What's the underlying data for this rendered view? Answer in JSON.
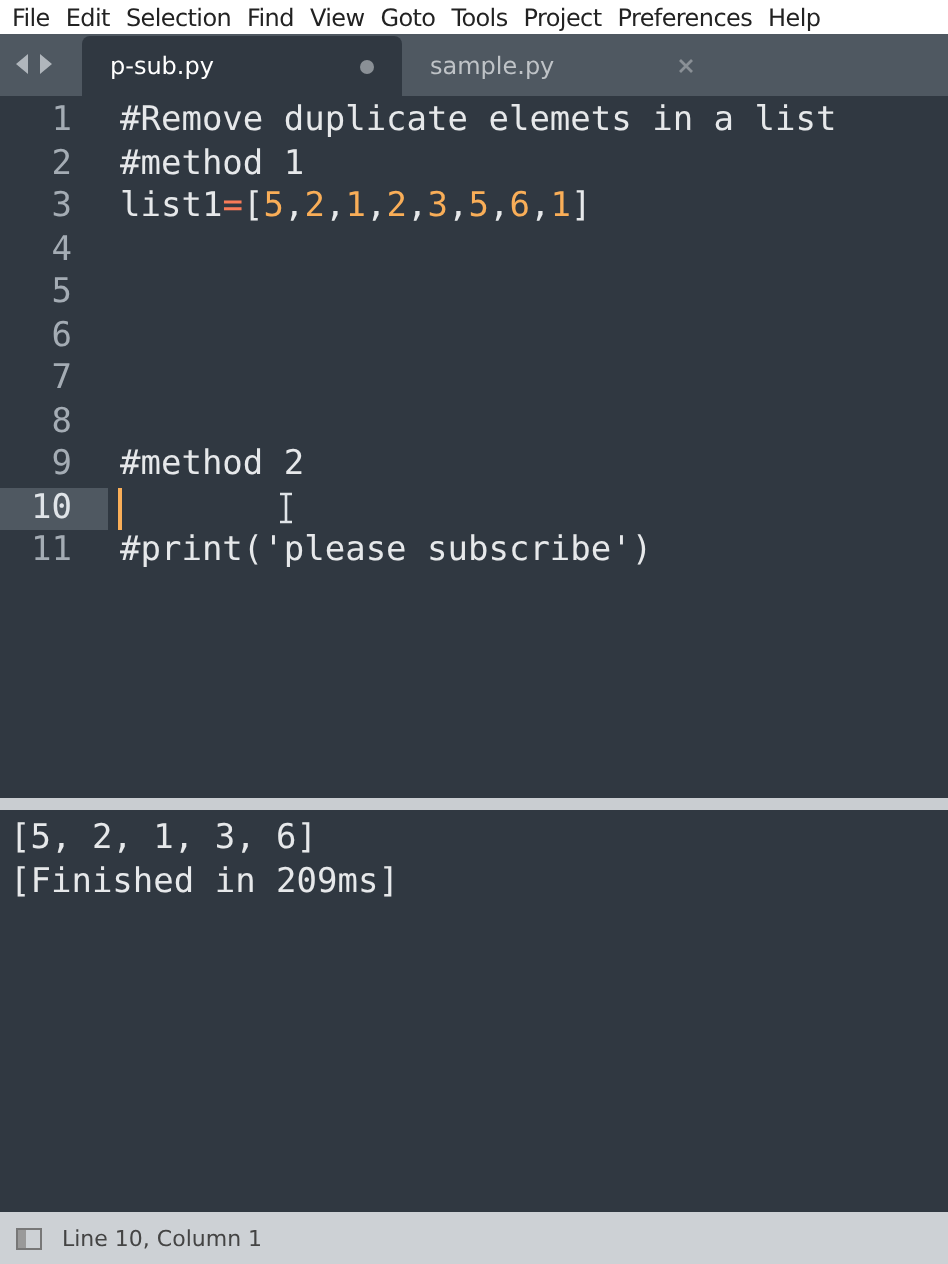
{
  "menu": [
    "File",
    "Edit",
    "Selection",
    "Find",
    "View",
    "Goto",
    "Tools",
    "Project",
    "Preferences",
    "Help"
  ],
  "tabs": [
    {
      "label": "p-sub.py",
      "selected": true,
      "modified": true
    },
    {
      "label": "sample.py",
      "selected": false,
      "modified": false
    }
  ],
  "editor": {
    "lines": [
      {
        "number": "1",
        "current": false,
        "tokens": [
          {
            "text": "#Remove duplicate elemets in a list",
            "kind": "comment"
          }
        ]
      },
      {
        "number": "2",
        "current": false,
        "tokens": [
          {
            "text": "#method 1",
            "kind": "comment"
          }
        ]
      },
      {
        "number": "3",
        "current": false,
        "tokens": [
          {
            "text": "list1",
            "kind": "plain"
          },
          {
            "text": "=",
            "kind": "operator"
          },
          {
            "text": "[",
            "kind": "plain"
          },
          {
            "text": "5",
            "kind": "number"
          },
          {
            "text": ",",
            "kind": "plain"
          },
          {
            "text": "2",
            "kind": "number"
          },
          {
            "text": ",",
            "kind": "plain"
          },
          {
            "text": "1",
            "kind": "number"
          },
          {
            "text": ",",
            "kind": "plain"
          },
          {
            "text": "2",
            "kind": "number"
          },
          {
            "text": ",",
            "kind": "plain"
          },
          {
            "text": "3",
            "kind": "number"
          },
          {
            "text": ",",
            "kind": "plain"
          },
          {
            "text": "5",
            "kind": "number"
          },
          {
            "text": ",",
            "kind": "plain"
          },
          {
            "text": "6",
            "kind": "number"
          },
          {
            "text": ",",
            "kind": "plain"
          },
          {
            "text": "1",
            "kind": "number"
          },
          {
            "text": "]",
            "kind": "plain"
          }
        ]
      },
      {
        "number": "4",
        "current": false
      },
      {
        "number": "5",
        "current": false
      },
      {
        "number": "6",
        "current": false
      },
      {
        "number": "7",
        "current": false
      },
      {
        "number": "8",
        "current": false
      },
      {
        "number": "9",
        "current": false,
        "tokens": [
          {
            "text": "#method 2",
            "kind": "comment"
          }
        ]
      },
      {
        "number": "10",
        "current": true
      },
      {
        "number": "11",
        "current": false,
        "tokens": [
          {
            "text": "#print('please subscribe')",
            "kind": "comment"
          }
        ]
      }
    ]
  },
  "output": [
    "[5, 2, 1, 3, 6]",
    "[Finished in 209ms]"
  ],
  "status_bar": {
    "text": "Line 10, Column 1"
  }
}
